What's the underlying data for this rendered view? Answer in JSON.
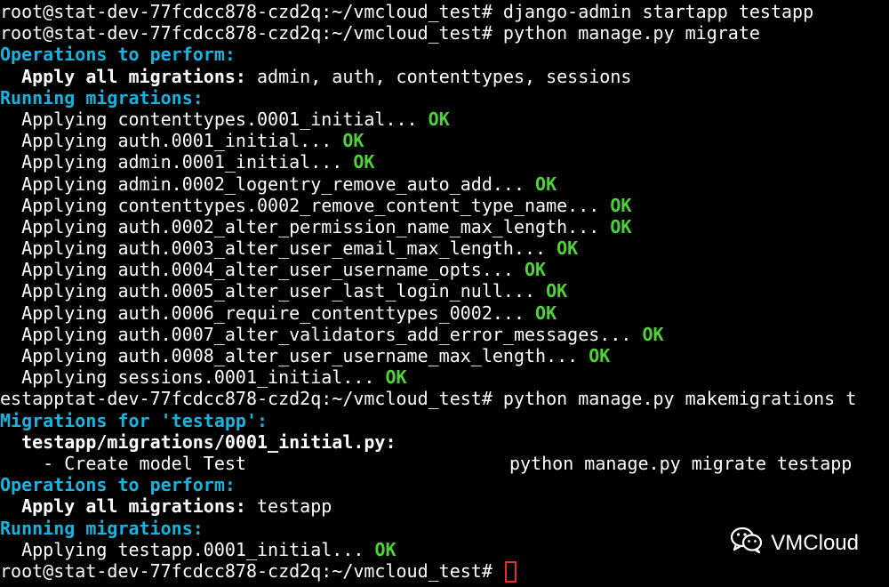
{
  "terminal": {
    "lines": [
      {
        "parts": [
          {
            "t": "root@stat-dev-77fcdcc878-czd2q:~/vmcloud_test# django-admin startapp testapp",
            "c": "white"
          }
        ]
      },
      {
        "parts": [
          {
            "t": "root@stat-dev-77fcdcc878-czd2q:~/vmcloud_test# python manage.py migrate",
            "c": "white"
          }
        ]
      },
      {
        "parts": [
          {
            "t": "Operations to perform:",
            "c": "cyan"
          }
        ]
      },
      {
        "parts": [
          {
            "t": "  Apply all migrations:",
            "c": "bold"
          },
          {
            "t": " admin, auth, contenttypes, sessions",
            "c": "white"
          }
        ]
      },
      {
        "parts": [
          {
            "t": "Running migrations:",
            "c": "cyan"
          }
        ]
      },
      {
        "parts": [
          {
            "t": "  Applying contenttypes.0001_initial...",
            "c": "white"
          },
          {
            "t": " OK",
            "c": "ok"
          }
        ]
      },
      {
        "parts": [
          {
            "t": "  Applying auth.0001_initial...",
            "c": "white"
          },
          {
            "t": " OK",
            "c": "ok"
          }
        ]
      },
      {
        "parts": [
          {
            "t": "  Applying admin.0001_initial...",
            "c": "white"
          },
          {
            "t": " OK",
            "c": "ok"
          }
        ]
      },
      {
        "parts": [
          {
            "t": "  Applying admin.0002_logentry_remove_auto_add...",
            "c": "white"
          },
          {
            "t": " OK",
            "c": "ok"
          }
        ]
      },
      {
        "parts": [
          {
            "t": "  Applying contenttypes.0002_remove_content_type_name...",
            "c": "white"
          },
          {
            "t": " OK",
            "c": "ok"
          }
        ]
      },
      {
        "parts": [
          {
            "t": "  Applying auth.0002_alter_permission_name_max_length...",
            "c": "white"
          },
          {
            "t": " OK",
            "c": "ok"
          }
        ]
      },
      {
        "parts": [
          {
            "t": "  Applying auth.0003_alter_user_email_max_length...",
            "c": "white"
          },
          {
            "t": " OK",
            "c": "ok"
          }
        ]
      },
      {
        "parts": [
          {
            "t": "  Applying auth.0004_alter_user_username_opts...",
            "c": "white"
          },
          {
            "t": " OK",
            "c": "ok"
          }
        ]
      },
      {
        "parts": [
          {
            "t": "  Applying auth.0005_alter_user_last_login_null...",
            "c": "white"
          },
          {
            "t": " OK",
            "c": "ok"
          }
        ]
      },
      {
        "parts": [
          {
            "t": "  Applying auth.0006_require_contenttypes_0002...",
            "c": "white"
          },
          {
            "t": " OK",
            "c": "ok"
          }
        ]
      },
      {
        "parts": [
          {
            "t": "  Applying auth.0007_alter_validators_add_error_messages...",
            "c": "white"
          },
          {
            "t": " OK",
            "c": "ok"
          }
        ]
      },
      {
        "parts": [
          {
            "t": "  Applying auth.0008_alter_user_username_max_length...",
            "c": "white"
          },
          {
            "t": " OK",
            "c": "ok"
          }
        ]
      },
      {
        "parts": [
          {
            "t": "  Applying sessions.0001_initial...",
            "c": "white"
          },
          {
            "t": " OK",
            "c": "ok"
          }
        ]
      },
      {
        "parts": [
          {
            "t": "estapptat-dev-77fcdcc878-czd2q:~/vmcloud_test# python manage.py makemigrations t",
            "c": "white"
          }
        ]
      },
      {
        "parts": [
          {
            "t": "Migrations for 'testapp':",
            "c": "cyan"
          }
        ]
      },
      {
        "parts": [
          {
            "t": "  testapp/migrations/0001_initial.py:",
            "c": "bold"
          }
        ]
      },
      {
        "parts": [
          {
            "t": "    - Create model Test",
            "c": "white"
          },
          {
            "t": "python manage.py migrate testapp",
            "c": "white",
            "right": true
          }
        ]
      },
      {
        "parts": [
          {
            "t": "Operations to perform:",
            "c": "cyan"
          }
        ]
      },
      {
        "parts": [
          {
            "t": "  Apply all migrations:",
            "c": "bold"
          },
          {
            "t": " testapp",
            "c": "white"
          }
        ]
      },
      {
        "parts": [
          {
            "t": "Running migrations:",
            "c": "cyan"
          }
        ]
      },
      {
        "parts": [
          {
            "t": "  Applying testapp.0001_initial...",
            "c": "white"
          },
          {
            "t": " OK",
            "c": "ok"
          }
        ]
      },
      {
        "parts": [
          {
            "t": "root@stat-dev-77fcdcc878-czd2q:~/vmcloud_test# ",
            "c": "white"
          }
        ],
        "cursor": true
      }
    ]
  },
  "watermark": {
    "label": "VMCloud",
    "icon": "wechat-icon"
  },
  "colors": {
    "background": "#000000",
    "cyan": "#16b3e0",
    "ok": "#4fd13a",
    "cursor": "#e0302b"
  }
}
